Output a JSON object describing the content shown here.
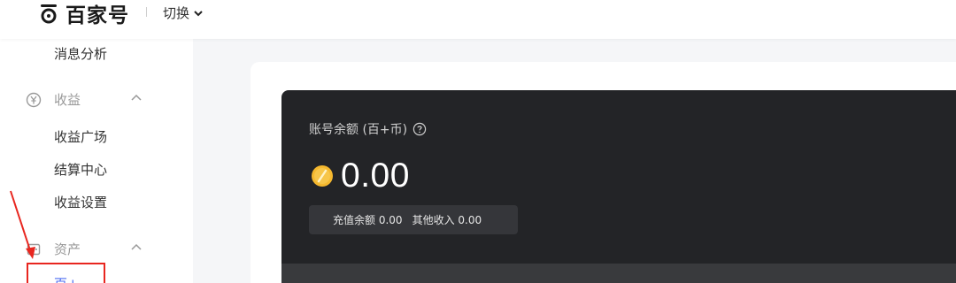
{
  "header": {
    "logo_text": "百家号",
    "switch_label": "切换"
  },
  "sidebar": {
    "items_before": [
      {
        "label": "消息分析"
      }
    ],
    "groups": [
      {
        "label": "收益",
        "icon": "yen-circle-icon",
        "items": [
          {
            "label": "收益广场"
          },
          {
            "label": "结算中心"
          },
          {
            "label": "收益设置"
          }
        ]
      },
      {
        "label": "资产",
        "icon": "wallet-icon",
        "items": [
          {
            "label": "百+"
          }
        ]
      }
    ]
  },
  "balance": {
    "title": "账号余额 (百+币)",
    "amount": "0.00",
    "recharge_label": "充值余额",
    "recharge_value": "0.00",
    "other_label": "其他收入",
    "other_value": "0.00"
  },
  "colors": {
    "accent": "#4e6ef2",
    "annotation_red": "#e8261f",
    "dark_panel": "#232427",
    "coin_gold": "#f5b82e"
  }
}
